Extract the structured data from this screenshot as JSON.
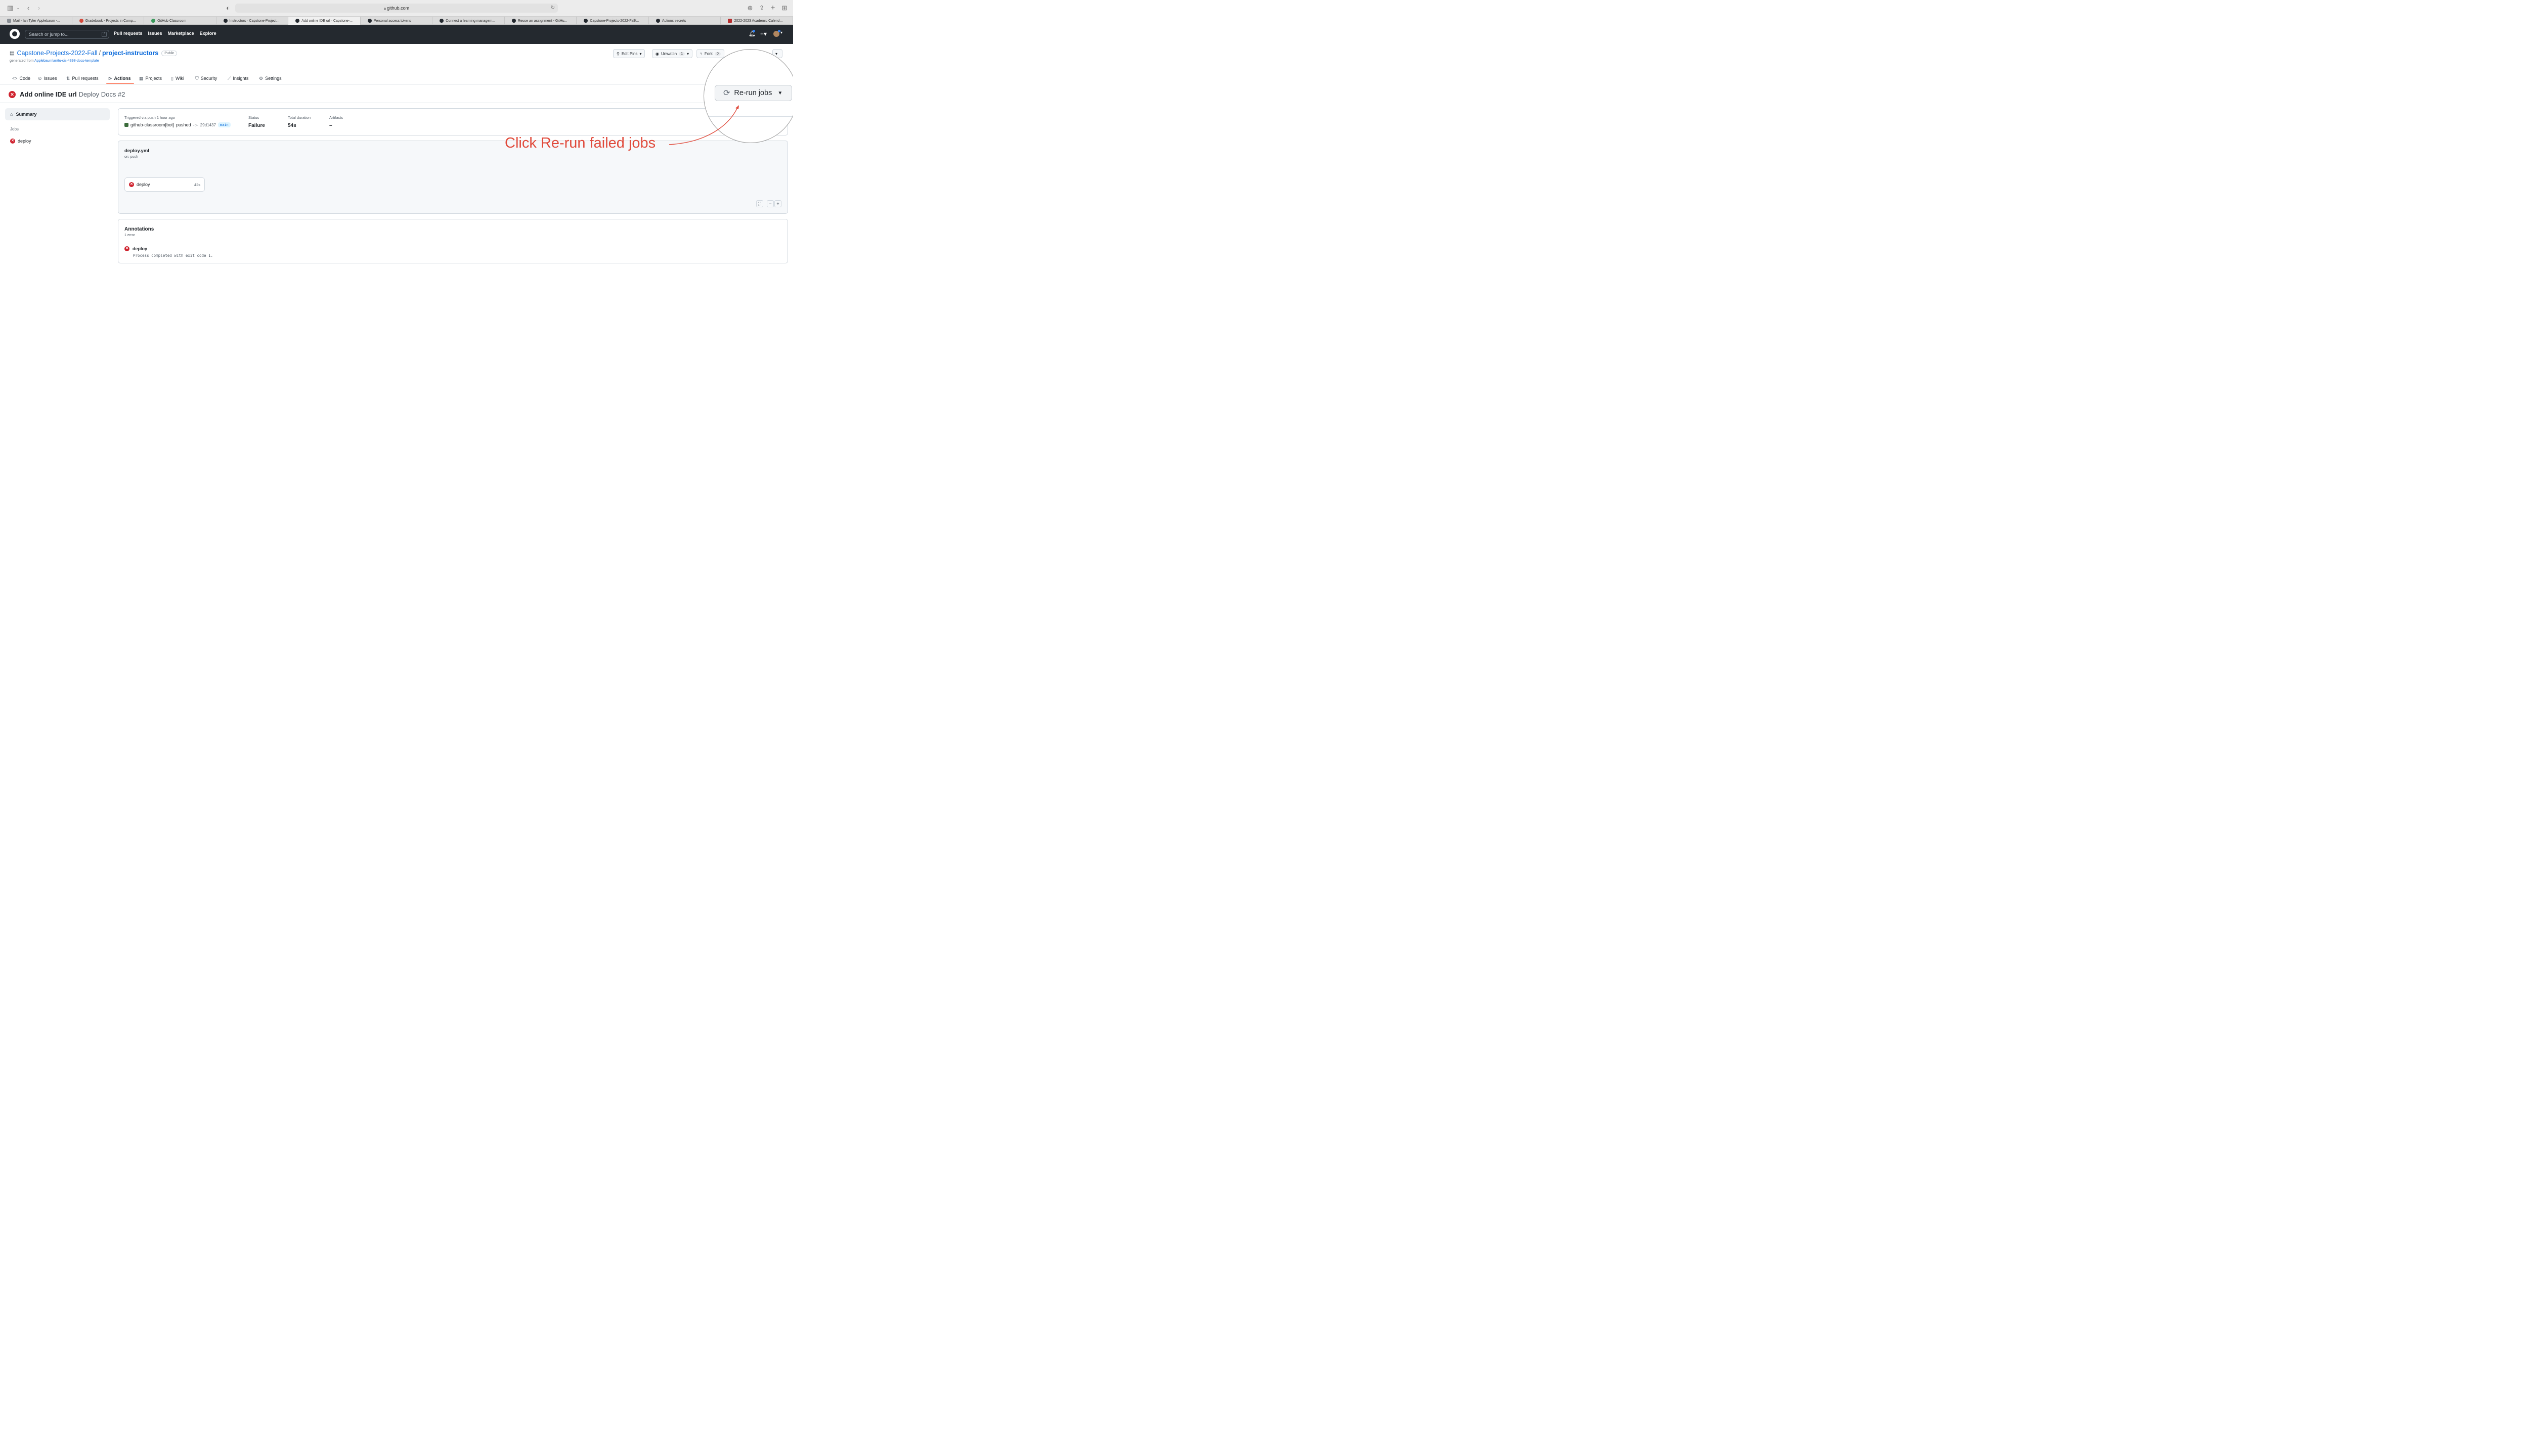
{
  "browser": {
    "url": "github.com",
    "tabs": [
      {
        "label": "Mail - Ian Tyler Applebaum -...",
        "favicon": "mail-icon",
        "active": false
      },
      {
        "label": "Gradebook - Projects in Comp...",
        "favicon": "gradebook-icon",
        "active": false
      },
      {
        "label": "GitHub Classroom",
        "favicon": "classroom-icon",
        "active": false
      },
      {
        "label": "Instructors · Capstone-Project...",
        "favicon": "github-icon",
        "active": false
      },
      {
        "label": "Add online IDE url · Capstone-...",
        "favicon": "github-icon",
        "active": true
      },
      {
        "label": "Personal access tokens",
        "favicon": "github-icon",
        "active": false
      },
      {
        "label": "Connect a learning managem...",
        "favicon": "github-icon",
        "active": false
      },
      {
        "label": "Reuse an assignment - GitHu...",
        "favicon": "github-icon",
        "active": false
      },
      {
        "label": "Capstone-Projects-2022-Fall/...",
        "favicon": "github-icon",
        "active": false
      },
      {
        "label": "Actions secrets",
        "favicon": "github-icon",
        "active": false
      },
      {
        "label": "2022-2023 Academic Calend...",
        "favicon": "calendar-icon",
        "active": false
      }
    ]
  },
  "gh": {
    "search_placeholder": "Search or jump to...",
    "search_shortcut": "/",
    "nav": [
      "Pull requests",
      "Issues",
      "Marketplace",
      "Explore"
    ]
  },
  "repo": {
    "owner": "Capstone-Projects-2022-Fall",
    "separator": "/",
    "name": "project-instructors",
    "visibility": "Public",
    "generated_prefix": "generated from",
    "template": "Applebaumlan/tu-cis-4398-docs-template",
    "edit_pins_label": "Edit Pins",
    "unwatch_label": "Unwatch",
    "unwatch_count": "1",
    "fork_label": "Fork",
    "fork_count": "0",
    "tabs": [
      {
        "label": "Code",
        "icon": "code-icon"
      },
      {
        "label": "Issues",
        "icon": "issue-icon"
      },
      {
        "label": "Pull requests",
        "icon": "pull-request-icon"
      },
      {
        "label": "Actions",
        "icon": "play-icon",
        "active": true
      },
      {
        "label": "Projects",
        "icon": "table-icon"
      },
      {
        "label": "Wiki",
        "icon": "book-icon"
      },
      {
        "label": "Security",
        "icon": "shield-icon"
      },
      {
        "label": "Insights",
        "icon": "graph-icon"
      },
      {
        "label": "Settings",
        "icon": "gear-icon"
      }
    ]
  },
  "run": {
    "title": "Add online IDE url",
    "workflow": "Deploy Docs #2",
    "status_color": "#cf222e"
  },
  "sidebar": {
    "summary_label": "Summary",
    "jobs_heading": "Jobs",
    "jobs": [
      "deploy"
    ]
  },
  "summary": {
    "trigger": "Triggered via push 1 hour ago",
    "actor": "github-classroom[bot]",
    "action": "pushed",
    "commit": "29d1437",
    "branch": "main",
    "status_label": "Status",
    "status_value": "Failure",
    "duration_label": "Total duration",
    "duration_value": "54s",
    "artifacts_label": "Artifacts",
    "artifacts_value": "–"
  },
  "graph": {
    "workflow_file": "deploy.yml",
    "trigger": "on: push",
    "job_name": "deploy",
    "job_duration": "42s"
  },
  "annotations": {
    "title": "Annotations",
    "count": "1 error",
    "job": "deploy",
    "message": "Process completed with exit code 1."
  },
  "overlay": {
    "rerun_label": "Re-run jobs",
    "instruction": "Click Re-run failed jobs",
    "accent": "#e0493a"
  }
}
